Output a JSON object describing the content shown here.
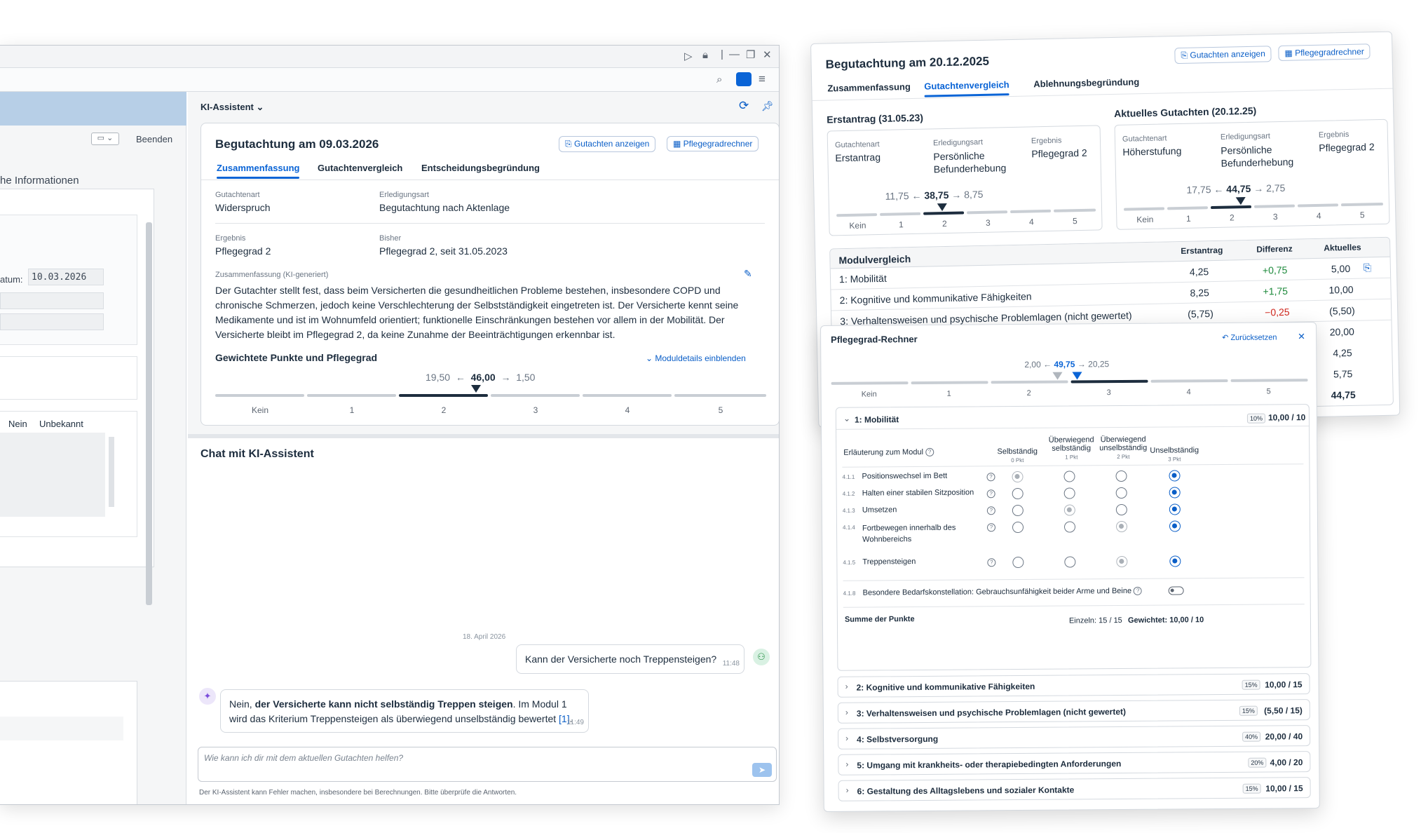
{
  "window": {
    "close": "✕",
    "beenden": "Beenden",
    "info_heading": "he Informationen",
    "datum_label": "atum:",
    "datum_value": "10.03.2026",
    "col_nein": "Nein",
    "col_unbekannt": "Unbekannt"
  },
  "ai": {
    "title": "KI-Assistent",
    "card": {
      "title": "Begutachtung am 09.03.2026",
      "btn_view": "Gutachten anzeigen",
      "btn_calc": "Pflegegradrechner",
      "tabs": [
        "Zusammenfassung",
        "Gutachtenvergleich",
        "Entscheidungsbegründung"
      ],
      "gutachtenart_label": "Gutachtenart",
      "gutachtenart_value": "Widerspruch",
      "erledigung_label": "Erledigungsart",
      "erledigung_value": "Begutachtung nach Aktenlage",
      "ergebnis_label": "Ergebnis",
      "ergebnis_value": "Pflegegrad 2",
      "bisher_label": "Bisher",
      "bisher_value": "Pflegegrad 2, seit 31.05.2023",
      "summary_label": "Zusammenfassung (KI-generiert)",
      "summary_text": "Der Gutachter stellt fest, dass beim Versicherten die gesundheitlichen Probleme bestehen, insbesondere COPD und chronische Schmerzen, jedoch keine Verschlechterung der Selbstständigkeit eingetreten ist. Der Versicherte kennt seine Medikamente und ist im Wohnumfeld orientiert; funktionelle Einschränkungen bestehen vor allem in der Mobilität. Der Versicherte bleibt im Pflegegrad 2, da keine Zunahme der Beeinträchtigungen erkennbar ist.",
      "points_heading": "Gewichtete Punkte und Pflegegrad",
      "module_toggle": "Moduldetails einblenden",
      "pts_lower": "19,50",
      "pts_value": "46,00",
      "pts_upper": "1,50",
      "arrow_left": "←",
      "arrow_right": "→",
      "scale": [
        "Kein",
        "1",
        "2",
        "3",
        "4",
        "5"
      ],
      "active_level": 2
    },
    "chat": {
      "heading": "Chat mit KI-Assistent",
      "date": "18. April 2026",
      "user_msg": "Kann der Versicherte noch Treppensteigen?",
      "user_time": "11:48",
      "bot_pre": "Nein, ",
      "bot_bold": "der Versicherte kann nicht selbständig Treppen steigen",
      "bot_post": ". Im Modul 1 wird das Kriterium Treppensteigen als überwiegend unselbständig bewertet ",
      "bot_ref": "[1]",
      "bot_end": ".",
      "bot_time": "11:49",
      "input_placeholder": "Wie kann ich dir mit dem aktuellen Gutachten helfen?",
      "disclaimer": "Der KI-Assistent kann Fehler machen, insbesondere bei Berechnungen. Bitte überprüfe die Antworten."
    }
  },
  "compare": {
    "title": "Begutachtung am 20.12.2025",
    "btn_view": "Gutachten anzeigen",
    "btn_calc": "Pflegegradrechner",
    "tabs": [
      "Zusammenfassung",
      "Gutachtenvergleich",
      "Ablehnungsbegründung"
    ],
    "left": {
      "heading": "Erstantrag (31.05.23)",
      "art_label": "Gutachtenart",
      "art_value": "Erstantrag",
      "erl_label": "Erledigungsart",
      "erl_value": "Persönliche Befunderhebung",
      "erg_label": "Ergebnis",
      "erg_value": "Pflegegrad 2",
      "lower": "11,75",
      "value": "38,75",
      "upper": "8,75"
    },
    "right": {
      "heading": "Aktuelles Gutachten (20.12.25)",
      "art_label": "Gutachtenart",
      "art_value": "Höherstufung",
      "erl_label": "Erledigungsart",
      "erl_value": "Persönliche Befunderhebung",
      "erg_label": "Ergebnis",
      "erg_value": "Pflegegrad 2",
      "lower": "17,75",
      "value": "44,75",
      "upper": "2,75"
    },
    "scale": [
      "Kein",
      "1",
      "2",
      "3",
      "4",
      "5"
    ],
    "table": {
      "heading": "Modulvergleich",
      "col1": "Erstantrag",
      "col2": "Differenz",
      "col3": "Aktuelles",
      "rows": [
        {
          "name": "1: Mobilität",
          "a": "4,25",
          "d": "+0,75",
          "c": "5,00"
        },
        {
          "name": "2: Kognitive und kommunikative Fähigkeiten",
          "a": "8,25",
          "d": "+1,75",
          "c": "10,00"
        },
        {
          "name": "3: Verhaltensweisen und psychische Problemlagen (nicht gewertet)",
          "a": "(5,75)",
          "d": "−0,25",
          "c": "(5,50)"
        }
      ],
      "extra": [
        "20,00",
        "4,25",
        "5,75",
        "44,75"
      ]
    }
  },
  "calc": {
    "title": "Pflegegrad-Rechner",
    "reset": "Zurücksetzen",
    "close": "✕",
    "lower": "2,00",
    "value": "49,75",
    "upper": "20,25",
    "scale": [
      "Kein",
      "1",
      "2",
      "3",
      "4",
      "5"
    ],
    "m1": {
      "label": "1: Mobilität",
      "pct": "10%",
      "score": "10,00 / 10",
      "explain": "Erläuterung zum Modul",
      "cols": [
        {
          "t": "Selbständig",
          "p": "0 Pkt"
        },
        {
          "t": "Überwiegend selbständig",
          "p": "1 Pkt"
        },
        {
          "t": "Überwiegend unselbständig",
          "p": "2 Pkt"
        },
        {
          "t": "Unselbständig",
          "p": "3 Pkt"
        }
      ],
      "items": [
        {
          "code": "4.1.1",
          "label": "Positionswechsel im Bett"
        },
        {
          "code": "4.1.2",
          "label": "Halten einer stabilen Sitzposition"
        },
        {
          "code": "4.1.3",
          "label": "Umsetzen"
        },
        {
          "code": "4.1.4",
          "label": "Fortbewegen innerhalb des Wohnbereichs"
        },
        {
          "code": "4.1.5",
          "label": "Treppensteigen"
        }
      ],
      "special_code": "4.1.8",
      "special": "Besondere Bedarfskonstellation: Gebrauchsunfähigkeit beider Arme und Beine",
      "sum_label": "Summe der Punkte",
      "einzeln": "Einzeln: 15 / 15",
      "gewichtet": "Gewichtet: 10,00 / 10"
    },
    "modules": [
      {
        "label": "2: Kognitive und kommunikative Fähigkeiten",
        "pct": "15%",
        "score": "10,00 / 15"
      },
      {
        "label": "3: Verhaltensweisen und psychische Problemlagen (nicht gewertet)",
        "pct": "15%",
        "score": "(5,50 / 15)"
      },
      {
        "label": "4: Selbstversorgung",
        "pct": "40%",
        "score": "20,00 / 40"
      },
      {
        "label": "5: Umgang mit krankheits- oder therapiebedingten Anforderungen",
        "pct": "20%",
        "score": "4,00 / 20"
      },
      {
        "label": "6: Gestaltung des Alltagslebens und sozialer Kontakte",
        "pct": "15%",
        "score": "10,00 / 15"
      }
    ]
  },
  "colors": {
    "accent": "#0a64d6",
    "positive": "#1e8a3c",
    "negative": "#d0271d",
    "dark": "#1d2d3e"
  }
}
